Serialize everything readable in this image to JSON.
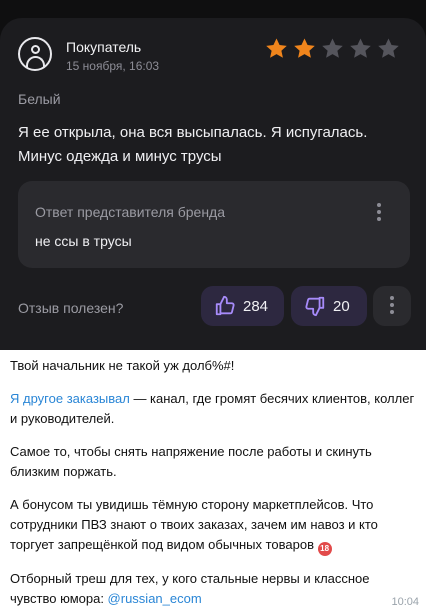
{
  "review": {
    "author": "Покупатель",
    "date": "15 ноября, 16:03",
    "rating": 2,
    "max_rating": 5,
    "star_color_filled": "#f0851c",
    "star_color_empty": "#55555c",
    "variant": "Белый",
    "text": "Я ее открыла, она вся высыпалась. Я испугалась. Минус одежда и минус трусы",
    "brand_reply_title": "Ответ представителя бренда",
    "brand_reply_text": "не ссы в трусы",
    "helpful_label": "Отзыв полезен?",
    "likes": "284",
    "dislikes": "20"
  },
  "post": {
    "line1": "Твой начальник не такой уж долб%#!",
    "channel_link": "Я другое заказывал",
    "line2_rest": " — канал, где громят бесячих клиентов, коллег и руководителей.",
    "line3": "Самое то, чтобы снять напряжение после работы и скинуть близким поржать.",
    "line4": "А бонусом ты увидишь тёмную сторону маркетплейсов. Что сотрудники ПВЗ знают о твоих заказах, зачем им навоз и кто торгует запрещёнкой под видом обычных товаров",
    "adult_badge": "18",
    "line5": "Отборный треш для тех, у кого стальные нервы и классное чувство юмора: ",
    "handle": "@russian_ecom",
    "time": "10:04"
  },
  "accent_colors": {
    "link": "#2a86d6",
    "vote_bg": "#2d2840",
    "vote_icon": "#a78bfa"
  }
}
